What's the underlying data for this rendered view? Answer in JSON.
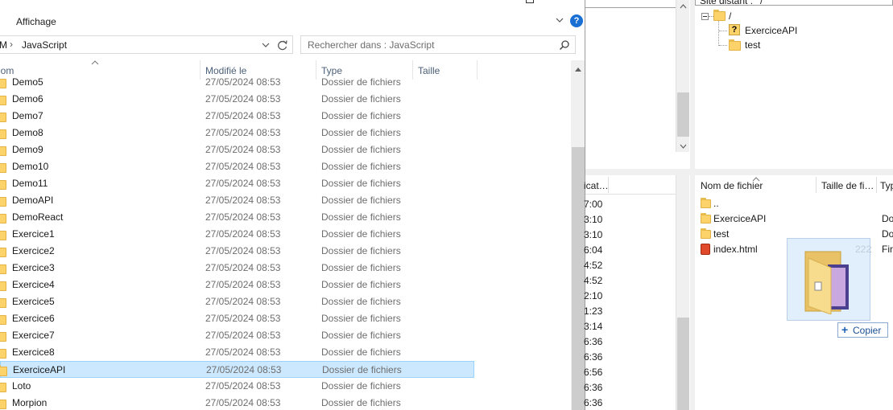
{
  "explorer": {
    "ribbon_tab": "Affichage",
    "help": "?",
    "breadcrumb_prefix": "M",
    "breadcrumb_sep": "›",
    "breadcrumb_folder": "JavaScript",
    "search_placeholder": "Rechercher dans : JavaScript",
    "columns": {
      "name": "Nom",
      "modified": "Modifié le",
      "type": "Type",
      "size": "Taille"
    },
    "rows": [
      {
        "name": "Demo5",
        "date": "27/05/2024 08:53",
        "type": "Dossier de fichiers"
      },
      {
        "name": "Demo6",
        "date": "27/05/2024 08:53",
        "type": "Dossier de fichiers"
      },
      {
        "name": "Demo7",
        "date": "27/05/2024 08:53",
        "type": "Dossier de fichiers"
      },
      {
        "name": "Demo8",
        "date": "27/05/2024 08:53",
        "type": "Dossier de fichiers"
      },
      {
        "name": "Demo9",
        "date": "27/05/2024 08:53",
        "type": "Dossier de fichiers"
      },
      {
        "name": "Demo10",
        "date": "27/05/2024 08:53",
        "type": "Dossier de fichiers"
      },
      {
        "name": "Demo11",
        "date": "27/05/2024 08:53",
        "type": "Dossier de fichiers"
      },
      {
        "name": "DemoAPI",
        "date": "27/05/2024 08:53",
        "type": "Dossier de fichiers"
      },
      {
        "name": "DemoReact",
        "date": "27/05/2024 08:53",
        "type": "Dossier de fichiers"
      },
      {
        "name": "Exercice1",
        "date": "27/05/2024 08:53",
        "type": "Dossier de fichiers"
      },
      {
        "name": "Exercice2",
        "date": "27/05/2024 08:53",
        "type": "Dossier de fichiers"
      },
      {
        "name": "Exercice3",
        "date": "27/05/2024 08:53",
        "type": "Dossier de fichiers"
      },
      {
        "name": "Exercice4",
        "date": "27/05/2024 08:53",
        "type": "Dossier de fichiers"
      },
      {
        "name": "Exercice5",
        "date": "27/05/2024 08:53",
        "type": "Dossier de fichiers"
      },
      {
        "name": "Exercice6",
        "date": "27/05/2024 08:53",
        "type": "Dossier de fichiers"
      },
      {
        "name": "Exercice7",
        "date": "27/05/2024 08:53",
        "type": "Dossier de fichiers"
      },
      {
        "name": "Exercice8",
        "date": "27/05/2024 08:53",
        "type": "Dossier de fichiers"
      },
      {
        "name": "ExerciceAPI",
        "date": "27/05/2024 08:53",
        "type": "Dossier de fichiers",
        "selected": true
      },
      {
        "name": "Loto",
        "date": "27/05/2024 08:53",
        "type": "Dossier de fichiers"
      },
      {
        "name": "Morpion",
        "date": "27/05/2024 08:53",
        "type": "Dossier de fichiers"
      }
    ]
  },
  "filezilla": {
    "remote_site_label": "Site distant :",
    "remote_path": "/",
    "tree": {
      "root": "/",
      "items": [
        "ExerciceAPI",
        "test"
      ]
    },
    "local_partial_header": "icat…",
    "local_times": [
      "7:00",
      "3:10",
      "3:10",
      "6:04",
      "4:52",
      "4:52",
      "2:10",
      "1:23",
      "3:14",
      "6:36",
      "6:36",
      "6:56",
      "6:36",
      "6:36"
    ],
    "remote_columns": {
      "name": "Nom de fichier",
      "size": "Taille de fi…",
      "type": "Typ"
    },
    "remote_files": [
      {
        "name": "..",
        "size": "",
        "type": "",
        "icon": "folder-icon"
      },
      {
        "name": "ExerciceAPI",
        "size": "",
        "type": "Do",
        "icon": "folder-icon"
      },
      {
        "name": "test",
        "size": "",
        "type": "Do",
        "icon": "folder-icon"
      },
      {
        "name": "index.html",
        "size": "222",
        "type": "Fir",
        "icon": "html-file-icon"
      }
    ],
    "drag_tooltip": "Copier",
    "drag_tooltip_symbol": "+"
  }
}
